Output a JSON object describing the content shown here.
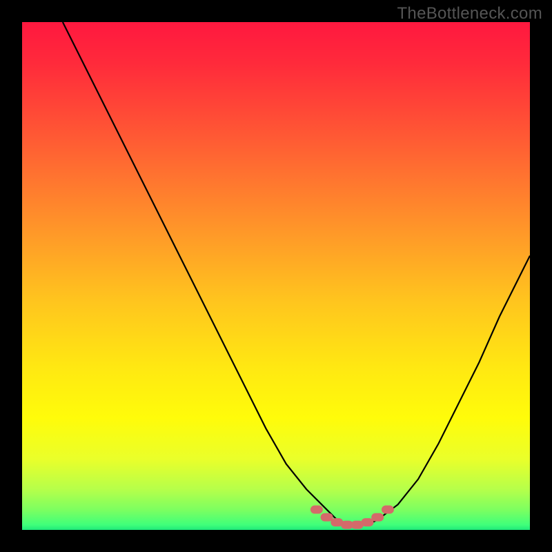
{
  "watermark": "TheBottleneck.com",
  "gradient_stops": [
    {
      "offset": 0.0,
      "color": "#ff183f"
    },
    {
      "offset": 0.08,
      "color": "#ff2a3b"
    },
    {
      "offset": 0.18,
      "color": "#ff4a36"
    },
    {
      "offset": 0.3,
      "color": "#ff7230"
    },
    {
      "offset": 0.42,
      "color": "#ff9a28"
    },
    {
      "offset": 0.55,
      "color": "#ffc51e"
    },
    {
      "offset": 0.68,
      "color": "#ffe812"
    },
    {
      "offset": 0.78,
      "color": "#fffc0a"
    },
    {
      "offset": 0.86,
      "color": "#eaff2a"
    },
    {
      "offset": 0.92,
      "color": "#b6ff4a"
    },
    {
      "offset": 0.96,
      "color": "#7dff60"
    },
    {
      "offset": 0.99,
      "color": "#40ff7a"
    },
    {
      "offset": 1.0,
      "color": "#20e87a"
    }
  ],
  "accent_marker_color": "#d46a6a",
  "curve_color": "#000000",
  "chart_data": {
    "type": "line",
    "title": "",
    "xlabel": "",
    "ylabel": "",
    "xlim": [
      0,
      100
    ],
    "ylim": [
      0,
      100
    ],
    "series": [
      {
        "name": "curve",
        "x": [
          8,
          12,
          16,
          20,
          24,
          28,
          32,
          36,
          40,
          44,
          48,
          52,
          56,
          60,
          62,
          64,
          66,
          68,
          70,
          74,
          78,
          82,
          86,
          90,
          94,
          98,
          100
        ],
        "y": [
          100,
          92,
          84,
          76,
          68,
          60,
          52,
          44,
          36,
          28,
          20,
          13,
          8,
          4,
          2,
          1,
          1,
          1,
          2,
          5,
          10,
          17,
          25,
          33,
          42,
          50,
          54
        ]
      }
    ],
    "markers": {
      "note": "dotted accent segment near curve minimum",
      "x": [
        58,
        60,
        62,
        64,
        66,
        68,
        70,
        72
      ],
      "y": [
        4,
        2.5,
        1.5,
        1,
        1,
        1.5,
        2.5,
        4
      ]
    }
  }
}
